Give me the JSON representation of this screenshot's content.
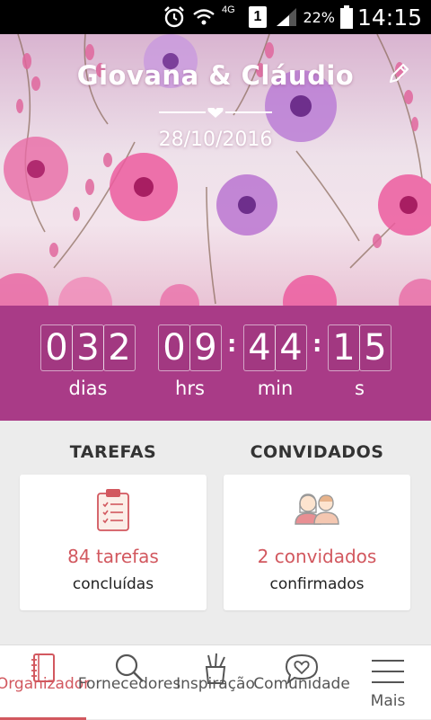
{
  "status_bar": {
    "network": "4G",
    "sim": "1",
    "battery_percent": "22%",
    "time": "14:15"
  },
  "hero": {
    "couple_names": "Giovana & Cláudio",
    "date": "28/10/2016"
  },
  "countdown": {
    "days": [
      "0",
      "3",
      "2"
    ],
    "hours": [
      "0",
      "9"
    ],
    "minutes": [
      "4",
      "4"
    ],
    "seconds": [
      "1",
      "5"
    ],
    "separator": ":",
    "labels": {
      "days": "dias",
      "hours": "hrs",
      "minutes": "min",
      "seconds": "s"
    },
    "background_color": "#a93b87"
  },
  "summary": {
    "tasks": {
      "title": "TAREFAS",
      "value": "84 tarefas",
      "caption": "concluídas",
      "icon": "clipboard-checklist-icon"
    },
    "guests": {
      "title": "CONVIDADOS",
      "value": "2 convidados",
      "caption": "confirmados",
      "icon": "couple-guests-icon"
    },
    "accent_color": "#d2585f"
  },
  "bottom_nav": {
    "items": [
      {
        "label": "Organizador",
        "icon": "notebook-icon",
        "active": true
      },
      {
        "label": "Fornecedores",
        "icon": "search-icon",
        "active": false
      },
      {
        "label": "Inspiração",
        "icon": "pencil-cup-icon",
        "active": false
      },
      {
        "label": "Comunidade",
        "icon": "heart-bubble-icon",
        "active": false
      },
      {
        "label": "Mais",
        "icon": "menu-icon",
        "active": false
      }
    ]
  }
}
